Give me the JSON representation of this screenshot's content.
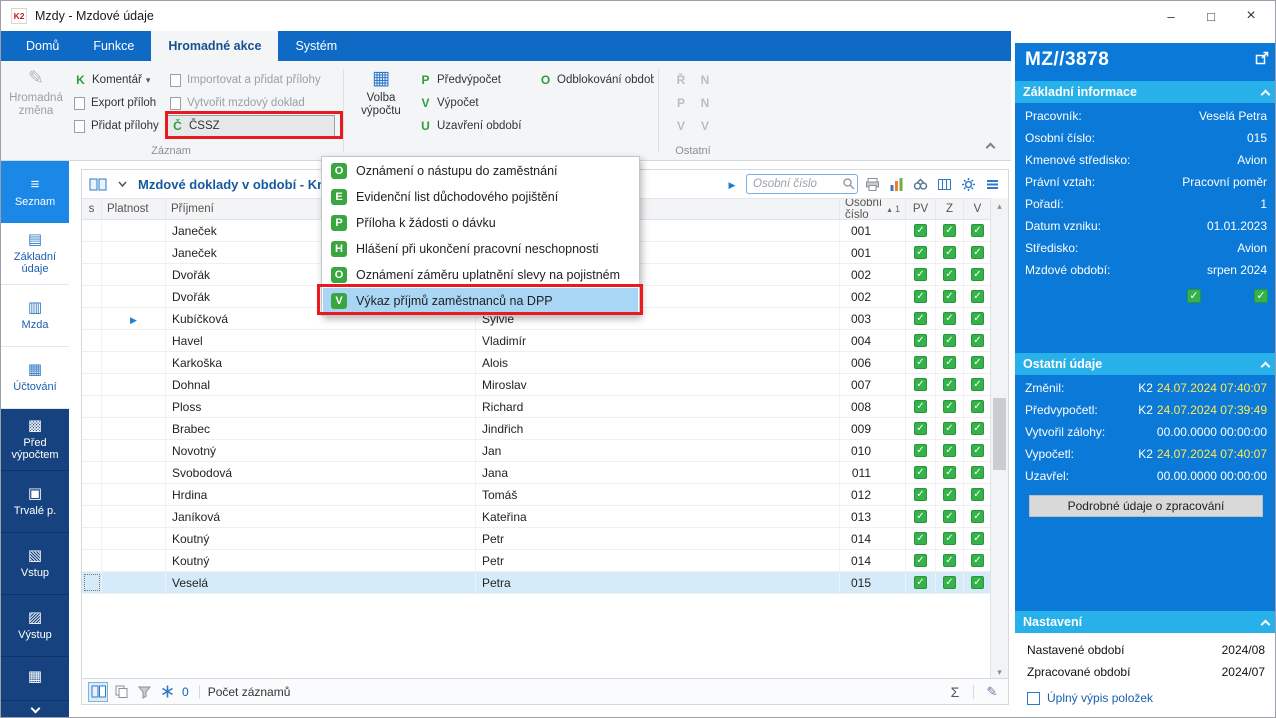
{
  "window": {
    "title": "Mzdy - Mzdové údaje"
  },
  "ribbon": {
    "tabs": [
      {
        "label": "Domů",
        "active": false
      },
      {
        "label": "Funkce",
        "active": false
      },
      {
        "label": "Hromadné akce",
        "active": true
      },
      {
        "label": "Systém",
        "active": false
      }
    ],
    "group_labels": {
      "zaznam": "Záznam",
      "ostatni": "Ostatní"
    },
    "buttons": {
      "hromadna_zmena": {
        "label": "Hromadná změna",
        "enabled": false
      },
      "komentar": {
        "icon": "K",
        "label": "Komentář"
      },
      "export_priloh": {
        "label": "Export příloh"
      },
      "pridat_prilohy": {
        "label": "Přidat přílohy"
      },
      "importovat_prilohy": {
        "label": "Importovat a přidat přílohy",
        "enabled": false
      },
      "vytvorit_doklad": {
        "label": "Vytvořit mzdový doklad",
        "enabled": false
      },
      "cssz": {
        "icon": "Č",
        "label": "ČSSZ"
      },
      "volba_vypoctu": {
        "label": "Volba výpočtu"
      },
      "predvypocet": {
        "icon": "P",
        "label": "Předvýpočet"
      },
      "vypocet": {
        "icon": "V",
        "label": "Výpočet"
      },
      "uzavreni_obdobi": {
        "icon": "U",
        "label": "Uzavření období"
      },
      "odblokovani_obdobi": {
        "icon": "O",
        "label": "Odblokování období"
      },
      "disabled_letters": [
        "Ř",
        "N",
        "P",
        "N",
        "V",
        "V"
      ]
    }
  },
  "menu": {
    "items": [
      {
        "icon": "O",
        "label": "Oznámení o nástupu do zaměstnání",
        "selected": false
      },
      {
        "icon": "E",
        "label": "Evidenční list důchodového pojištění",
        "selected": false
      },
      {
        "icon": "P",
        "label": "Příloha k žádosti o dávku",
        "selected": false
      },
      {
        "icon": "H",
        "label": "Hlášení při ukončení pracovní neschopnosti",
        "selected": false
      },
      {
        "icon": "O",
        "label": "Oznámení záměru uplatnění slevy na pojistném",
        "selected": false
      },
      {
        "icon": "V",
        "label": "Výkaz příjmů zaměstnanců na DPP",
        "selected": true
      }
    ]
  },
  "sidebar": {
    "items": [
      {
        "label": "Seznam",
        "icon": "list-icon",
        "state": "selected"
      },
      {
        "label": "Základní údaje",
        "icon": "basic-data-icon",
        "state": "light"
      },
      {
        "label": "Mzda",
        "icon": "wage-icon",
        "state": "light"
      },
      {
        "label": "Účtování",
        "icon": "accounting-icon",
        "state": "light"
      },
      {
        "label": "Před výpočtem",
        "icon": "precalc-icon",
        "state": "dark"
      },
      {
        "label": "Trvalé p.",
        "icon": "permanent-icon",
        "state": "dark"
      },
      {
        "label": "Vstup",
        "icon": "input-icon",
        "state": "dark"
      },
      {
        "label": "Výstup",
        "icon": "output-icon",
        "state": "dark"
      },
      {
        "label": "",
        "icon": "grid-icon",
        "state": "dark"
      }
    ]
  },
  "table": {
    "title": "Mzdové doklady v období - Kni",
    "search_placeholder": "Osobní číslo",
    "columns": [
      "s",
      "Platnost",
      "Příjmení",
      "Jméno",
      "Osobní číslo",
      "PV",
      "Z",
      "V"
    ],
    "sort_rank": "1",
    "rows": [
      {
        "surname": "Janeček",
        "name": "",
        "number": "001",
        "pv": true,
        "z": true,
        "v": true,
        "play": false,
        "selected": false
      },
      {
        "surname": "Janeček",
        "name": "",
        "number": "001",
        "pv": true,
        "z": true,
        "v": true,
        "play": false,
        "selected": false
      },
      {
        "surname": "Dvořák",
        "name": "",
        "number": "002",
        "pv": true,
        "z": true,
        "v": true,
        "play": false,
        "selected": false
      },
      {
        "surname": "Dvořák",
        "name": "",
        "number": "002",
        "pv": true,
        "z": true,
        "v": true,
        "play": false,
        "selected": false
      },
      {
        "surname": "Kubíčková",
        "name": "Sylvie",
        "number": "003",
        "pv": true,
        "z": true,
        "v": true,
        "play": true,
        "selected": false
      },
      {
        "surname": "Havel",
        "name": "Vladimír",
        "number": "004",
        "pv": true,
        "z": true,
        "v": true,
        "play": false,
        "selected": false
      },
      {
        "surname": "Karkoška",
        "name": "Alois",
        "number": "006",
        "pv": true,
        "z": true,
        "v": true,
        "play": false,
        "selected": false
      },
      {
        "surname": "Dohnal",
        "name": "Miroslav",
        "number": "007",
        "pv": true,
        "z": true,
        "v": true,
        "play": false,
        "selected": false
      },
      {
        "surname": "Ploss",
        "name": "Richard",
        "number": "008",
        "pv": true,
        "z": true,
        "v": true,
        "play": false,
        "selected": false
      },
      {
        "surname": "Brabec",
        "name": "Jindřich",
        "number": "009",
        "pv": true,
        "z": true,
        "v": true,
        "play": false,
        "selected": false
      },
      {
        "surname": "Novotný",
        "name": "Jan",
        "number": "010",
        "pv": true,
        "z": true,
        "v": true,
        "play": false,
        "selected": false
      },
      {
        "surname": "Svobodová",
        "name": "Jana",
        "number": "011",
        "pv": true,
        "z": true,
        "v": true,
        "play": false,
        "selected": false
      },
      {
        "surname": "Hrdina",
        "name": "Tomáš",
        "number": "012",
        "pv": true,
        "z": true,
        "v": true,
        "play": false,
        "selected": false
      },
      {
        "surname": "Janíková",
        "name": "Kateřina",
        "number": "013",
        "pv": true,
        "z": true,
        "v": true,
        "play": false,
        "selected": false
      },
      {
        "surname": "Koutný",
        "name": "Petr",
        "number": "014",
        "pv": true,
        "z": true,
        "v": true,
        "play": false,
        "selected": false
      },
      {
        "surname": "Koutný",
        "name": "Petr",
        "number": "014",
        "pv": true,
        "z": true,
        "v": true,
        "play": false,
        "selected": false
      },
      {
        "surname": "Veselá",
        "name": "Petra",
        "number": "015",
        "pv": true,
        "z": true,
        "v": true,
        "play": false,
        "selected": true
      }
    ],
    "status": {
      "count": "0",
      "count_label": "Počet záznamů"
    }
  },
  "panel": {
    "id": "MZ//3878",
    "sections": {
      "zakladni": {
        "title": "Základní informace",
        "rows": [
          {
            "label": "Pracovník:",
            "value": "Veselá Petra"
          },
          {
            "label": "Osobní číslo:",
            "value": "015"
          },
          {
            "label": "Kmenové středisko:",
            "value": "Avion"
          },
          {
            "label": "Právní vztah:",
            "value": "Pracovní poměr"
          },
          {
            "label": "Pořadí:",
            "value": "1"
          },
          {
            "label": "Datum vzniku:",
            "value": "01.01.2023"
          },
          {
            "label": "Středisko:",
            "value": "Avion"
          },
          {
            "label": "Mzdové období:",
            "value": "srpen 2024"
          }
        ]
      },
      "ostatni": {
        "title": "Ostatní údaje",
        "rows": [
          {
            "label": "Změnil:",
            "prefix": "K2",
            "value": "24.07.2024 07:40:07",
            "highlight": true
          },
          {
            "label": "Předvypočetl:",
            "prefix": "K2",
            "value": "24.07.2024 07:39:49",
            "highlight": true
          },
          {
            "label": "Vytvořil zálohy:",
            "prefix": "",
            "value": "00.00.0000 00:00:00",
            "highlight": false
          },
          {
            "label": "Vypočetl:",
            "prefix": "K2",
            "value": "24.07.2024 07:40:07",
            "highlight": true
          },
          {
            "label": "Uzavřel:",
            "prefix": "",
            "value": "00.00.0000 00:00:00",
            "highlight": false
          }
        ],
        "button": "Podrobné údaje o zpracování"
      },
      "nastaveni": {
        "title": "Nastavení",
        "rows": [
          {
            "label": "Nastavené období",
            "value": "2024/08"
          },
          {
            "label": "Zpracované období",
            "value": "2024/07"
          }
        ],
        "checkbox_label": "Úplný výpis položek",
        "checkbox_checked": false
      }
    }
  }
}
